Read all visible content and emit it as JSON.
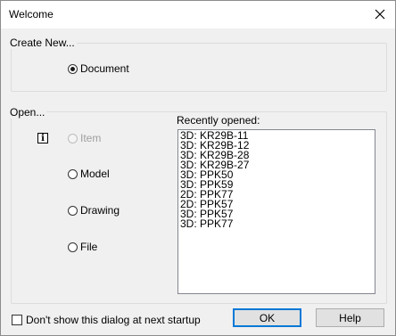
{
  "window": {
    "title": "Welcome"
  },
  "create_new": {
    "label": "Create New...",
    "options": [
      {
        "label": "Document",
        "checked": true
      }
    ]
  },
  "open": {
    "label": "Open...",
    "options": [
      {
        "label": "Item",
        "checked": false,
        "enabled": false
      },
      {
        "label": "Model",
        "checked": false,
        "enabled": true
      },
      {
        "label": "Drawing",
        "checked": false,
        "enabled": true
      },
      {
        "label": "File",
        "checked": false,
        "enabled": true
      }
    ],
    "info_icon": "info-icon"
  },
  "recent": {
    "label": "Recently opened:",
    "items": [
      "3D: KR29B-11",
      "3D: KR29B-12",
      "3D: KR29B-28",
      "3D: KR29B-27",
      "3D: PPK50",
      "3D: PPK59",
      "2D: PPK77",
      "2D: PPK57",
      "3D: PPK57",
      "3D: PPK77"
    ]
  },
  "footer": {
    "dont_show_label": "Don't show this dialog at next startup",
    "ok_label": "OK",
    "help_label": "Help"
  }
}
